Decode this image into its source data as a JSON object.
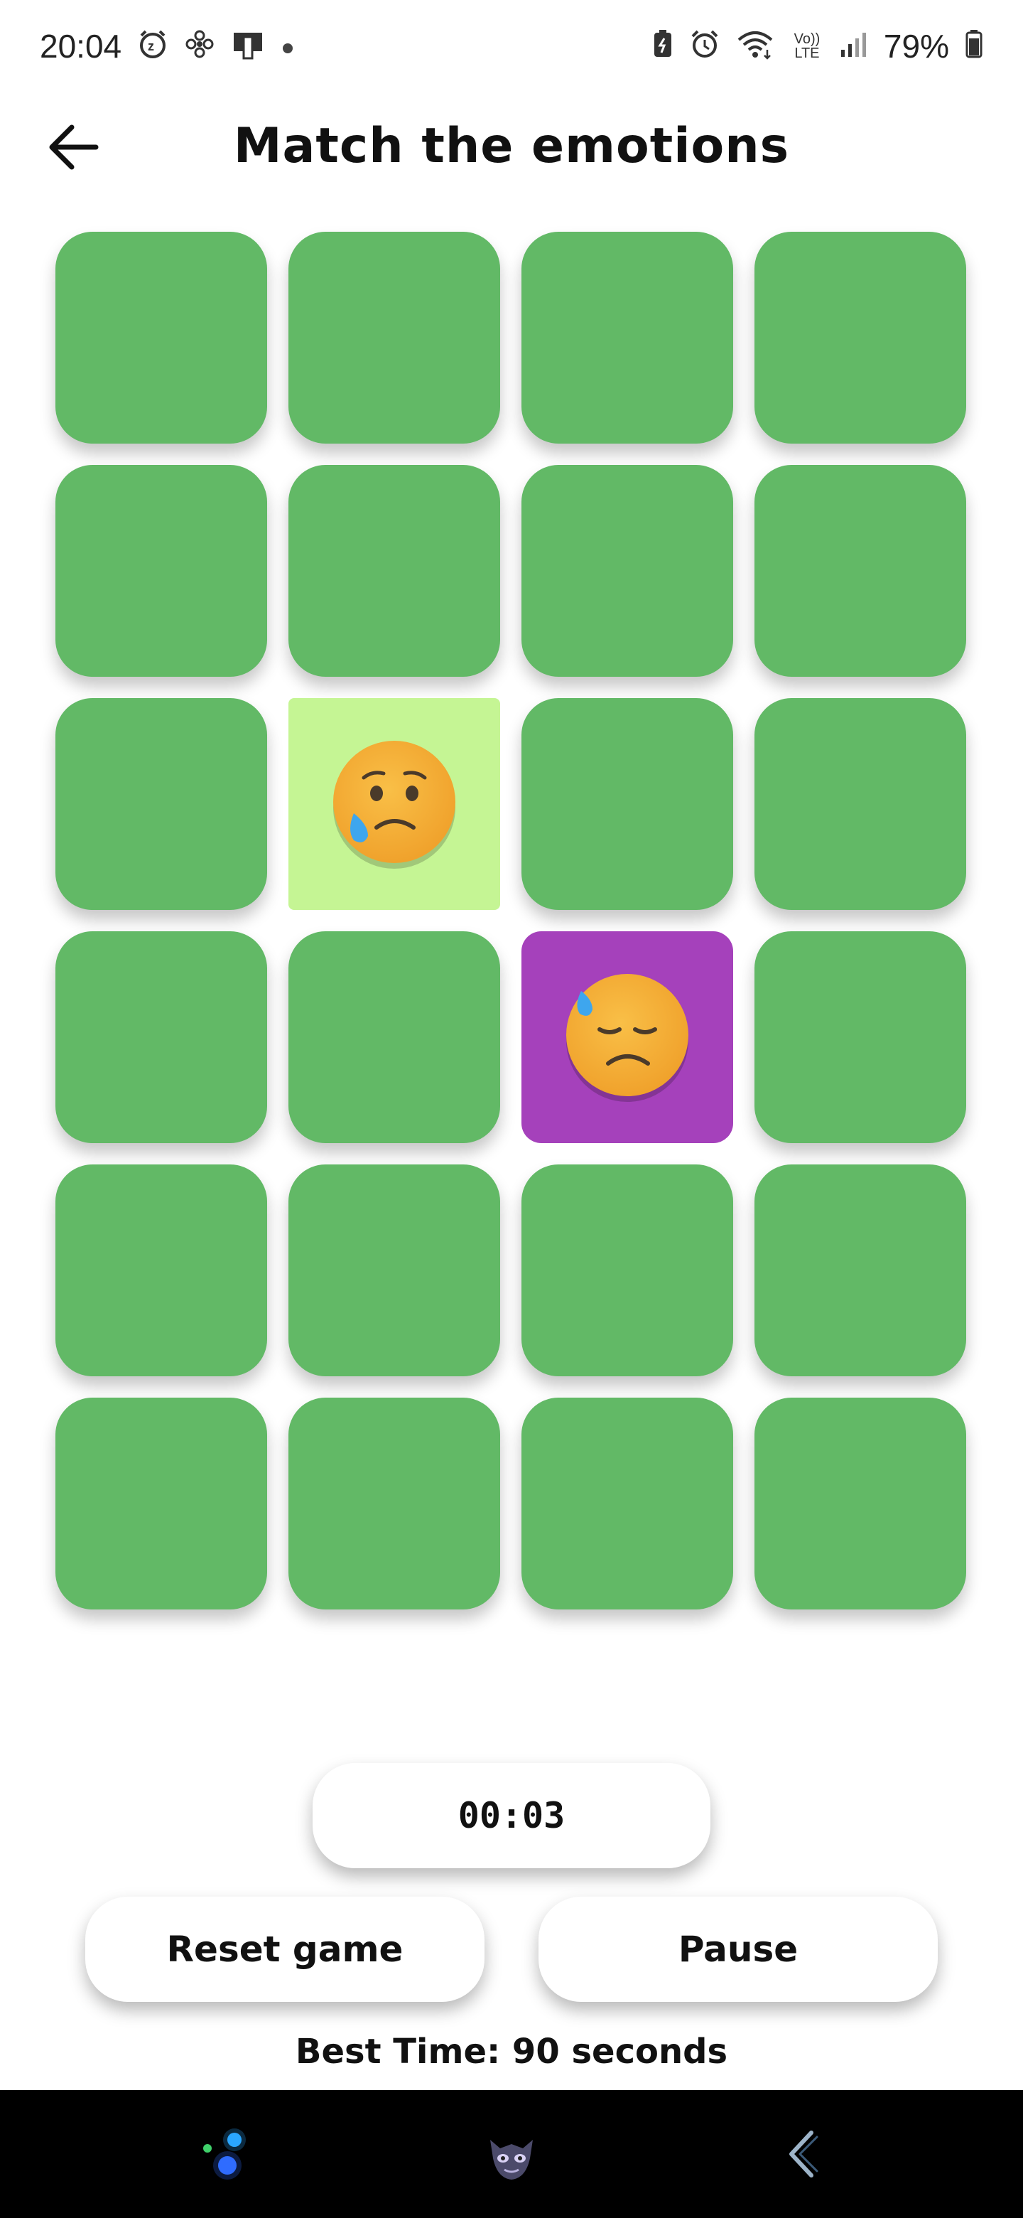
{
  "status_bar": {
    "time": "20:04",
    "battery": "79%",
    "network_label": "Vo)) LTE",
    "icons_left": [
      "alarm-snooze-icon",
      "fan-icon",
      "screen-mirror-icon",
      "dot-icon"
    ],
    "icons_right": [
      "battery-saver-icon",
      "alarm-icon",
      "wifi-icon",
      "volte-icon",
      "signal-icon",
      "battery-icon"
    ]
  },
  "header": {
    "title": "Match the emotions",
    "back_icon": "arrow-left-icon"
  },
  "grid": {
    "rows": 6,
    "columns": 4,
    "card_color": "#62b966",
    "revealed": [
      {
        "row": 3,
        "col": 2,
        "emoji": "crying-face",
        "background": "#c5f594"
      },
      {
        "row": 4,
        "col": 3,
        "emoji": "sad-sweat-face",
        "background": "#a541bb"
      }
    ]
  },
  "timer": {
    "value": "00:03"
  },
  "controls": {
    "reset_label": "Reset game",
    "pause_label": "Pause"
  },
  "best_time": {
    "text": "Best Time: 90 seconds"
  },
  "nav_bar": {
    "items": [
      "assistant-orbs-icon",
      "dragon-avatar-icon",
      "back-gesture-icon"
    ]
  }
}
